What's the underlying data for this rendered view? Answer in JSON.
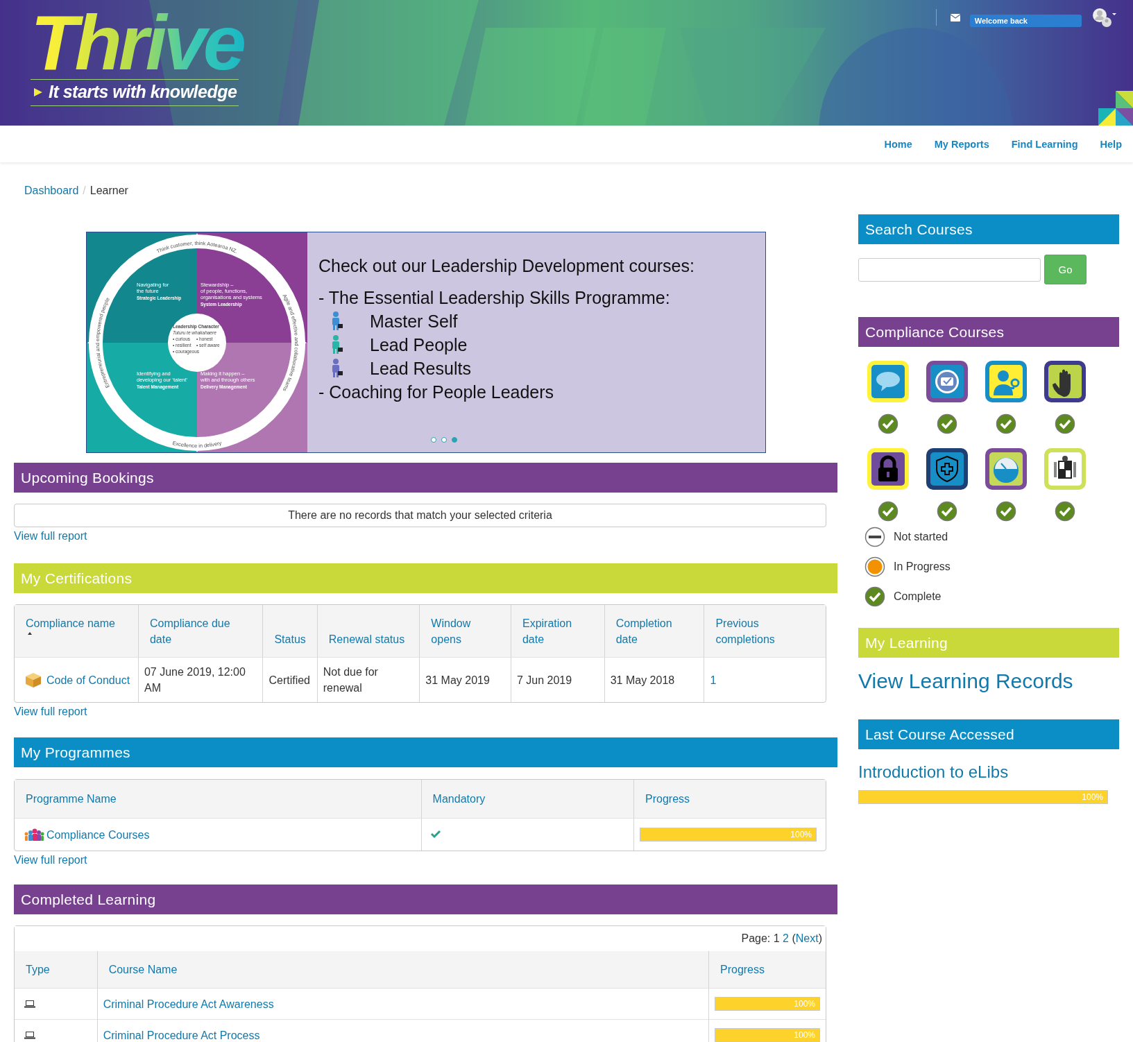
{
  "header": {
    "logo": "Thrive",
    "tagline": "It starts with knowledge",
    "welcome": "Welcome back"
  },
  "nav": [
    {
      "label": "Home"
    },
    {
      "label": "My Reports"
    },
    {
      "label": "Find Learning"
    },
    {
      "label": "Help"
    }
  ],
  "breadcrumb": {
    "items": [
      {
        "label": "Dashboard",
        "link": true
      },
      {
        "label": "Learner",
        "link": false
      }
    ],
    "separator": "/"
  },
  "slide": {
    "wheel": {
      "outer_top": "Think customer, think Aotearoa NZ.",
      "outer_right": "Agile and effective and collaborative teams",
      "outer_bottom": "Excellence in delivery",
      "outer_left": "Entrepreneurial and empowered people",
      "quadrants": [
        {
          "lines": [
            "Navigating for",
            "the future"
          ],
          "title": "Strategic Leadership"
        },
        {
          "lines": [
            "Stewardship –",
            "of people, functions,",
            "organisations and systems"
          ],
          "title": "System Leadership"
        },
        {
          "lines": [
            "Identifying and",
            "developing our ‘talent’"
          ],
          "title": "Talent Management"
        },
        {
          "lines": [
            "Making it happen –",
            "with and through others"
          ],
          "title": "Delivery Management"
        }
      ],
      "center": {
        "title": "Leadership Character",
        "subtitle": "Tuturu te whakahaere",
        "traits": [
          "• curious",
          "• honest",
          "• resilient",
          "• self aware",
          "• courageous"
        ]
      }
    },
    "heading": "Check out our Leadership Development courses:",
    "programme": "- The Essential Leadership Skills Programme:",
    "modules": [
      {
        "label": "Master Self",
        "color": "#3d8fd1"
      },
      {
        "label": "Lead People",
        "color": "#2bb3a6"
      },
      {
        "label": "Lead Results",
        "color": "#6a6fc0"
      }
    ],
    "coaching": "- Coaching for People Leaders",
    "dots": [
      {
        "selected": false
      },
      {
        "selected": false
      },
      {
        "selected": true
      }
    ]
  },
  "upcoming_bookings": {
    "title": "Upcoming Bookings",
    "empty": "There are no records that match your selected criteria",
    "link": "View full report"
  },
  "certifications": {
    "title": "My Certifications",
    "columns": [
      {
        "label": "Compliance name",
        "sorted": true
      },
      {
        "label": "Compliance due date",
        "sorted": false
      },
      {
        "label": "Status",
        "sorted": false
      },
      {
        "label": "Renewal status",
        "sorted": false
      },
      {
        "label": "Window opens",
        "sorted": false
      },
      {
        "label": "Expiration date",
        "sorted": false
      },
      {
        "label": "Completion date",
        "sorted": false
      },
      {
        "label": "Previous completions",
        "sorted": false
      }
    ],
    "rows": [
      {
        "name": "Code of Conduct",
        "due": "07 June 2019, 12:00 AM",
        "status": "Certified",
        "renewal": "Not due for renewal",
        "window_opens": "31 May 2019",
        "expiration": "7 Jun 2019",
        "completion": "31 May 2018",
        "previous": "1"
      }
    ],
    "link": "View full report"
  },
  "programmes": {
    "title": "My Programmes",
    "columns": [
      "Programme Name",
      "Mandatory",
      "Progress"
    ],
    "rows": [
      {
        "name": "Compliance Courses",
        "mandatory": true,
        "level": 1,
        "reading": "100%"
      }
    ],
    "link": "View full report"
  },
  "completed": {
    "title": "Completed Learning",
    "pager": {
      "label": "Page:",
      "pages": [
        {
          "label": "1",
          "selected": true
        },
        {
          "label": "2",
          "selected": false
        }
      ],
      "open": "(",
      "next": "Next",
      "close": ")"
    },
    "columns": [
      "Type",
      "Course Name",
      "Progress"
    ],
    "rows": [
      {
        "name": "Criminal Procedure Act Awareness",
        "level": 1,
        "reading": "100%"
      },
      {
        "name": "Criminal Procedure Act Process",
        "level": 1,
        "reading": "100%"
      }
    ]
  },
  "search": {
    "title": "Search Courses",
    "button": "Go"
  },
  "compliance": {
    "title": "Compliance Courses",
    "courses": [
      {
        "kind": "welcome",
        "complete": true
      },
      {
        "kind": "book",
        "complete": true
      },
      {
        "kind": "person-key",
        "complete": true
      },
      {
        "kind": "hand",
        "complete": true
      },
      {
        "kind": "lock",
        "complete": true
      },
      {
        "kind": "shield",
        "complete": true
      },
      {
        "kind": "gauge",
        "complete": true
      },
      {
        "kind": "crest",
        "complete": true
      }
    ],
    "legend": [
      {
        "kind": "not_started",
        "label": "Not started"
      },
      {
        "kind": "in_progress",
        "label": "In Progress"
      },
      {
        "kind": "complete",
        "label": "Complete"
      }
    ]
  },
  "my_learning": {
    "title": "My Learning",
    "link": "View Learning Records"
  },
  "last_course": {
    "title": "Last Course Accessed",
    "name": "Introduction to eLibs",
    "level": 1,
    "reading": "100%"
  }
}
